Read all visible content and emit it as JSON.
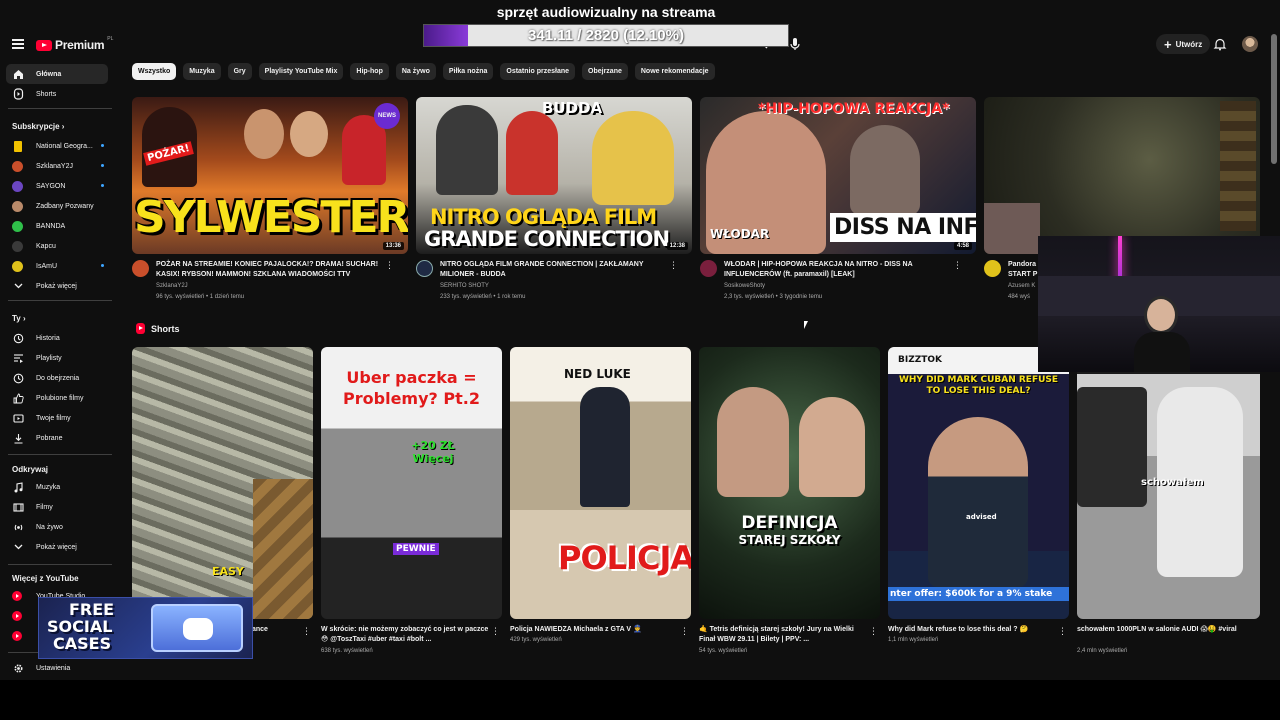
{
  "stream": {
    "title": "sprzęt audiowizualny na streama",
    "goal_text": "341.11 / 2820 (12.10%)",
    "goal_fraction": 0.121
  },
  "header": {
    "logo_text": "Premium",
    "logo_country": "PL",
    "create_label": "Utwórz"
  },
  "sidebar": {
    "main": [
      {
        "label": "Główna",
        "icon": "home-icon"
      },
      {
        "label": "Shorts",
        "icon": "shorts-icon"
      }
    ],
    "subs_heading": "Subskrypcje",
    "subs": [
      {
        "label": "National Geogra...",
        "color": "#f2c200",
        "live": true
      },
      {
        "label": "SzklanaY2J",
        "color": "#c94f2b",
        "live": true
      },
      {
        "label": "SAYGON",
        "color": "#6b46c1",
        "live": true
      },
      {
        "label": "Zadbany Pozwany",
        "color": "#b98a6a",
        "live": false
      },
      {
        "label": "BANNDA",
        "color": "#2fbf4a",
        "live": false
      },
      {
        "label": "Kapcu",
        "color": "#3a3a3a",
        "live": false
      },
      {
        "label": "IsAmU",
        "color": "#e0c21b",
        "live": true
      },
      {
        "label": "Pokaż więcej",
        "icon": "chevron-down-icon"
      }
    ],
    "you_heading": "Ty",
    "you": [
      {
        "label": "Historia",
        "icon": "history-icon"
      },
      {
        "label": "Playlisty",
        "icon": "playlist-icon"
      },
      {
        "label": "Do obejrzenia",
        "icon": "clock-icon"
      },
      {
        "label": "Polubione filmy",
        "icon": "thumb-up-icon"
      },
      {
        "label": "Twoje filmy",
        "icon": "video-icon"
      },
      {
        "label": "Pobrane",
        "icon": "download-icon"
      }
    ],
    "explore_heading": "Odkrywaj",
    "explore": [
      {
        "label": "Muzyka",
        "icon": "music-icon"
      },
      {
        "label": "Filmy",
        "icon": "film-icon"
      },
      {
        "label": "Na żywo",
        "icon": "live-icon"
      },
      {
        "label": "Pokaż więcej",
        "icon": "chevron-down-icon"
      }
    ],
    "more_heading": "Więcej z YouTube",
    "more": [
      {
        "label": "YouTube Studio"
      }
    ],
    "settings": "Ustawienia"
  },
  "chips": [
    "Wszystko",
    "Muzyka",
    "Gry",
    "Playlisty YouTube Mix",
    "Hip-hop",
    "Na żywo",
    "Piłka nożna",
    "Ostatnio przesłane",
    "Obejrzane",
    "Nowe rekomendacje"
  ],
  "videos": [
    {
      "thumb_text": "SYLWESTER!",
      "thumb_text2": "POŻAR!",
      "badge": "NEWS",
      "duration": "13:36",
      "title": "POŻAR NA STREAMIE! KONIEC PAJALOCKA!? DRAMA! SUCHAR! KASIX! RYBSON! MAMMON! SZKLANA WIADOMOŚCI TTV",
      "channel": "SzklanaY2J",
      "stats": "96 tys. wyświetleń • 1 dzień temu",
      "av": "#c94f2b"
    },
    {
      "thumb_text": "NITRO OGLĄDA FILM",
      "thumb_text2": "GRANDE CONNECTION",
      "badge": "BUDDA",
      "duration": "12:38",
      "title": "NITRO OGLĄDA FILM GRANDE CONNECTION | ZAKŁAMANY MILIONER - BUDDA",
      "channel": "SERHITO SHOTY",
      "stats": "233 tys. wyświetleń • 1 rok temu",
      "av": "#1f2a44"
    },
    {
      "thumb_text": "*HIP-HOPOWA REAKCJA*",
      "thumb_text2": "DISS NA INFLU",
      "badge": "WŁODAR",
      "duration": "4:58",
      "title": "WŁODAR | HIP-HOPOWA REAKCJA NA NITRO - DISS NA INFLUENCERÓW (ft. paramaxil) [LEAK]",
      "channel": "SosikoweShoty",
      "stats": "2,3 tys. wyświetleń • 3 tygodnie temu",
      "av": "#7a1f3d"
    },
    {
      "thumb_text": "",
      "title": "Pandora START P",
      "channel": "Azusem K",
      "stats": "484 wyś",
      "av": "#e0c21b"
    }
  ],
  "shorts_heading": "Shorts",
  "shorts": [
    {
      "overlay": "EASY",
      "title": "W skrócie: nie możemy zobaczyć co jest w ... ance",
      "views": ""
    },
    {
      "overlay": "Uber paczka = Problemy? Pt.2",
      "overlay2": "+20 ZŁ Więcej",
      "overlay3": "PEWNIE",
      "title": "W skrócie: nie możemy zobaczyć co jest w paczce 😳 @ToszTaxi #uber #taxi #bolt ...",
      "views": "638 tys. wyświetleń"
    },
    {
      "overlay": "NED LUKE",
      "overlay2": "POLICJA",
      "title": "Policja NAWIEDZA Michaela z GTA V 👮",
      "views": "429 tys. wyświetleń"
    },
    {
      "overlay": "DEFINICJA",
      "overlay2": "STAREJ SZKOŁY",
      "title": "🤙 Tetris definicją starej szkoły! Jury na Wielki Finał WBW 29.11 | Bilety | PPV: ...",
      "views": "54 tys. wyświetleń"
    },
    {
      "overlay": "BIZZTOK",
      "overlay2": "WHY DID MARK CUBAN REFUSE TO LOSE THIS DEAL?",
      "overlay3": "nter offer: $600k for a 9% stake",
      "overlay4": "advised",
      "title": "Why did Mark refuse to lose this deal ? 🤔",
      "views": "1,1 mln wyświetleń"
    },
    {
      "overlay": "schowałem",
      "title": "schowałem 1000PLN w salonie AUDI 😱🤑 #viral",
      "views": "2,4 mln wyświetleń"
    }
  ],
  "promo": {
    "line1": "FREE",
    "line2": "SOCIAL",
    "line3": "CASES"
  }
}
